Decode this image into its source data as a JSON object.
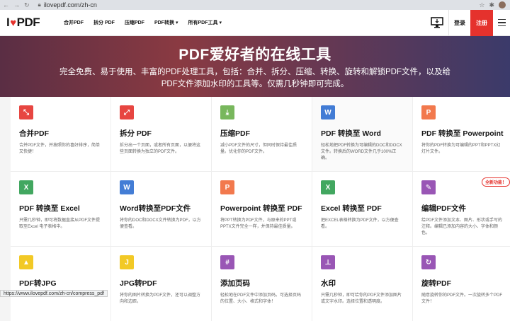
{
  "browser": {
    "url": "ilovepdf.com/zh-cn"
  },
  "header": {
    "logo_left": "I",
    "logo_right": "PDF",
    "nav": [
      "合并PDF",
      "拆分 PDF",
      "压缩PDF",
      "PDF转换",
      "所有PDF工具"
    ],
    "login": "登录",
    "signup": "注册"
  },
  "hero": {
    "title": "PDF爱好者的在线工具",
    "subtitle": "完全免费、易于使用、丰富的PDF处理工具，包括：合并、拆分、压缩、转换、旋转和解锁PDF文件，以及给PDF文件添加水印的工具等。仅需几秒钟即可完成。"
  },
  "tools": [
    {
      "title": "合并PDF",
      "desc": "合并PDF文件，并按照你的喜好排序，简单又快捷！",
      "icon": "merge-icon",
      "color": "#e5322d"
    },
    {
      "title": "拆分 PDF",
      "desc": "拆分出一个页面，或者所有页面，以便将这些页面转换为独立的PDF文件。",
      "icon": "split-icon",
      "color": "#e5322d"
    },
    {
      "title": "压缩PDF",
      "desc": "减小PDF文件的尺寸，但同时保持最佳质量。优化你的PDF文件。",
      "icon": "compress-icon",
      "color": "#6ab04c"
    },
    {
      "title": "PDF 转换至 Word",
      "desc": "轻松地把PDF转换为可编辑的DOC和DOCX文件。转换后的WORD文件几乎100%正确。",
      "icon": "pdf-to-word-icon",
      "color": "#2f6fd1"
    },
    {
      "title": "PDF 转换至 Powerpoint",
      "desc": "将你的PDF转换为可编辑的PPT和PPTX幻灯片文件。",
      "icon": "pdf-to-powerpoint-icon",
      "color": "#f16b3a"
    },
    {
      "title": "PDF 转换至 Excel",
      "desc": "只需几秒钟，即可将数据直接从PDF文件提取至Excel 电子表格中。",
      "icon": "pdf-to-excel-icon",
      "color": "#2e9e4f"
    },
    {
      "title": "Word转换至PDF文件",
      "desc": "将你的DOC和DOCX文件转换为PDF，以方便查看。",
      "icon": "word-to-pdf-icon",
      "color": "#2f6fd1"
    },
    {
      "title": "Powerpoint 转换至 PDF",
      "desc": "将PPT转换为PDF文件，与原来的PPT或PPTX文件完全一样，并保持最佳质量。",
      "icon": "powerpoint-to-pdf-icon",
      "color": "#f16b3a"
    },
    {
      "title": "Excel 转换至 PDF",
      "desc": "把EXCEL表格转换为PDF文件，以方便查看。",
      "icon": "excel-to-pdf-icon",
      "color": "#2e9e4f"
    },
    {
      "title": "编辑PDF文件",
      "desc": "给PDF文件添加文本、图片、形状或手写的注释。编辑已添加内容的大小、字体和颜色。",
      "icon": "edit-pdf-icon",
      "color": "#8e44ad",
      "badge": "全新功能！"
    },
    {
      "title": "PDF转JPG",
      "desc": "提取PDF文件中的所有图片，或将每一",
      "icon": "pdf-to-jpg-icon",
      "color": "#f1c40f"
    },
    {
      "title": "JPG转PDF",
      "desc": "将你的图片转换为PDF文件，还可以调整方向和边距。",
      "icon": "jpg-to-pdf-icon",
      "color": "#f1c40f"
    },
    {
      "title": "添加页码",
      "desc": "轻松地在PDF文件中添加页码。可选择页码的位置、大小、格式和字体！",
      "icon": "page-numbers-icon",
      "color": "#8e44ad"
    },
    {
      "title": "水印",
      "desc": "只需几秒钟，即可给你的PDF文件添加图片或文字水印。选择位置和透明度。",
      "icon": "watermark-icon",
      "color": "#8e44ad"
    },
    {
      "title": "旋转PDF",
      "desc": "随意旋转你的PDF文件。一次旋转多个PDF文件！",
      "icon": "rotate-icon",
      "color": "#8e44ad"
    }
  ],
  "status_bar": "https://www.ilovepdf.com/zh-cn/compress_pdf"
}
